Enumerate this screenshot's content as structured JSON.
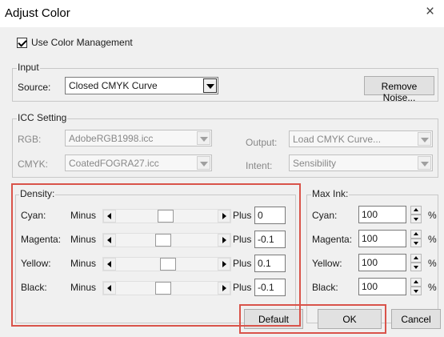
{
  "window": {
    "title": "Adjust Color",
    "close_glyph": "×"
  },
  "use_color_management": {
    "label": "Use Color Management",
    "checked": true
  },
  "input": {
    "legend": "Input",
    "source_label": "Source:",
    "source_value": "Closed CMYK Curve",
    "remove_noise_label": "Remove Noise..."
  },
  "icc": {
    "legend": "ICC Setting",
    "rgb_label": "RGB:",
    "rgb_value": "AdobeRGB1998.icc",
    "cmyk_label": "CMYK:",
    "cmyk_value": "CoatedFOGRA27.icc",
    "output_label": "Output:",
    "output_value": "Load CMYK Curve...",
    "intent_label": "Intent:",
    "intent_value": "Sensibility"
  },
  "density": {
    "legend": "Density:",
    "minus_label": "Minus",
    "plus_label": "Plus",
    "rows": [
      {
        "label": "Cyan:",
        "value": "0"
      },
      {
        "label": "Magenta:",
        "value": "-0.1"
      },
      {
        "label": "Yellow:",
        "value": "0.1"
      },
      {
        "label": "Black:",
        "value": "-0.1"
      }
    ]
  },
  "max_ink": {
    "legend": "Max Ink:",
    "unit": "%",
    "rows": [
      {
        "label": "Cyan:",
        "value": "100"
      },
      {
        "label": "Magenta:",
        "value": "100"
      },
      {
        "label": "Yellow:",
        "value": "100"
      },
      {
        "label": "Black:",
        "value": "100"
      }
    ]
  },
  "buttons": {
    "default_label": "Default",
    "ok_label": "OK",
    "cancel_label": "Cancel"
  },
  "colors": {
    "highlight": "#d9534a",
    "dialog_bg": "#f0f0f0"
  },
  "icons": {
    "close": "close-icon",
    "dropdown": "chevron-down-icon",
    "spin": "spin-arrows-icon"
  }
}
